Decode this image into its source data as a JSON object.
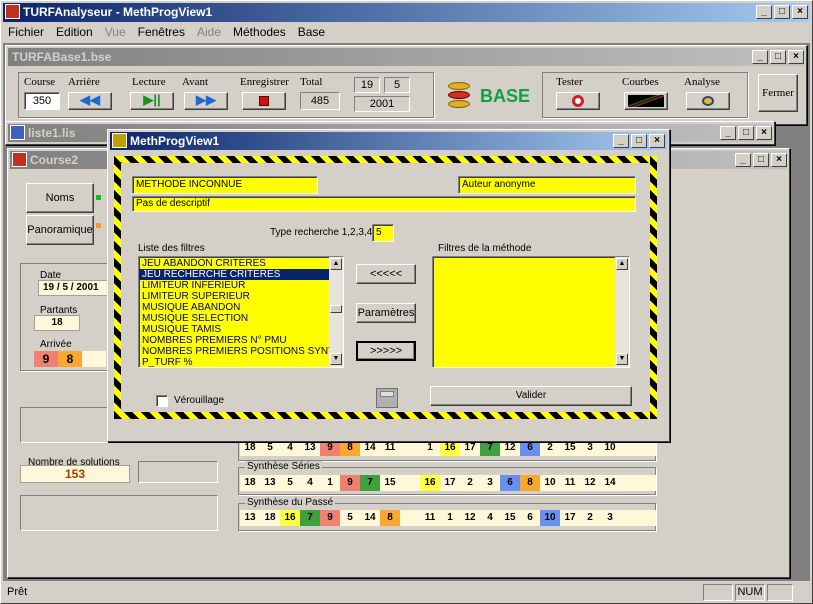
{
  "app": {
    "title": "TURFAnalyseur - MethProgView1",
    "menu": [
      "Fichier",
      "Edition",
      "Vue",
      "Fenêtres",
      "Aide",
      "Méthodes",
      "Base"
    ]
  },
  "base_window": {
    "title": "TURFABase1.bse",
    "course_label": "Course",
    "course_value": "350",
    "arriere_label": "Arrière",
    "lecture_label": "Lecture",
    "avant_label": "Avant",
    "enregistrer_label": "Enregistrer",
    "total_label": "Total",
    "total_value": "485",
    "day": "19",
    "month": "5",
    "year": "2001",
    "base_label": "BASE",
    "tester_label": "Tester",
    "courbes_label": "Courbes",
    "analyse_label": "Analyse",
    "fermer_label": "Fermer"
  },
  "liste_window": {
    "title": "liste1.lis"
  },
  "course_window": {
    "title": "Course2",
    "noms_label": "Noms",
    "panoramique_label": "Panoramique",
    "date_label": "Date",
    "date_value": "19 / 5 / 2001",
    "partants_label": "Partants",
    "partants_value": "18",
    "arrivee_label": "Arrivée",
    "arrivee": [
      "9",
      "8"
    ],
    "solutions_label": "Nombre de solutions",
    "solutions_value": "153",
    "row1": [
      "18",
      "5",
      "4",
      "13",
      "9",
      "8",
      "14",
      "11",
      "",
      "1",
      "16",
      "17",
      "7",
      "12",
      "6",
      "2",
      "15",
      "3",
      "10"
    ],
    "series_label": "Synthèse Séries",
    "row2": [
      "18",
      "13",
      "5",
      "4",
      "1",
      "9",
      "7",
      "15",
      "",
      "16",
      "17",
      "2",
      "3",
      "6",
      "8",
      "10",
      "11",
      "12",
      "14"
    ],
    "passe_label": "Synthèse du Passé",
    "row3": [
      "13",
      "18",
      "16",
      "7",
      "9",
      "5",
      "14",
      "8",
      "",
      "11",
      "1",
      "12",
      "4",
      "15",
      "6",
      "10",
      "17",
      "2",
      "3"
    ]
  },
  "dialog": {
    "title": "MethProgView1",
    "method_name": "METHODE INCONNUE",
    "author": "Auteur anonyme",
    "description": "Pas de descriptif",
    "type_label": "Type recherche 1,2,3,4,5",
    "type_value": "5",
    "filters_label": "Liste des filtres",
    "method_filters_label": "Filtres de la méthode",
    "filters": [
      "JEU ABANDON CRITERES",
      "JEU RECHERCHE CRITERES",
      "LIMITEUR INFERIEUR",
      "LIMITEUR SUPERIEUR",
      "MUSIQUE ABANDON",
      "MUSIQUE SELECTION",
      "MUSIQUE TAMIS",
      "NOMBRES PREMIERS N° PMU",
      "NOMBRES PREMIERS POSITIONS SYNTH",
      "P_TURF %"
    ],
    "selected_index": 1,
    "remove_label": "<<<<<",
    "params_label": "Paramètres",
    "add_label": ">>>>>",
    "lock_label": "Vérouillage",
    "validate_label": "Valider"
  },
  "status": {
    "text": "Prêt",
    "num": "NUM"
  },
  "colors": {
    "red": "#f08070",
    "orange": "#f8a830",
    "yellow": "#ffff40",
    "green": "#40a040",
    "blue": "#6890f0",
    "cream": "#fff8d8"
  }
}
